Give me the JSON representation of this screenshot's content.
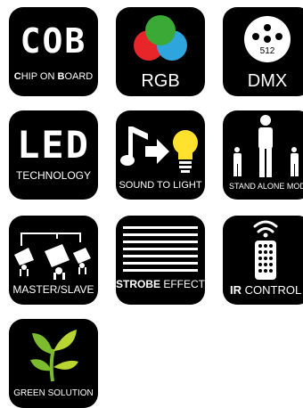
{
  "tiles": [
    {
      "id": "cob",
      "big": "COB",
      "caption_a": "C",
      "caption_b": "HIP ON ",
      "caption_c": "B",
      "caption_d": "OARD",
      "icon": "cob-dot-letters-icon"
    },
    {
      "id": "rgb",
      "caption": "RGB",
      "icon": "rgb-circles-icon",
      "colors": [
        "#e8262a",
        "#3aa935",
        "#2fa5dd"
      ]
    },
    {
      "id": "dmx",
      "caption": "DMX",
      "connector_label": "512",
      "icon": "dmx-connector-icon"
    },
    {
      "id": "led",
      "big": "LED",
      "caption": "TECHNOLOGY",
      "icon": "led-dot-letters-icon"
    },
    {
      "id": "sound",
      "caption": "SOUND TO LIGHT",
      "icon": "note-to-bulb-icon",
      "colors": [
        "#ffe12e"
      ]
    },
    {
      "id": "standalone",
      "caption": "STAND ALONE MODE",
      "icon": "standalone-figures-icon"
    },
    {
      "id": "masterslave",
      "caption": "MASTER/SLAVE",
      "icon": "linked-spotlights-icon"
    },
    {
      "id": "strobe",
      "caption_bold": "STROBE",
      "caption_rest": " EFFECT",
      "icon": "strobe-lines-icon"
    },
    {
      "id": "ir",
      "caption_bold": "IR",
      "caption_rest": " CONTROL",
      "icon": "remote-control-icon"
    },
    {
      "id": "green",
      "caption": "GREEN SOLUTION",
      "icon": "green-sprout-icon",
      "colors": [
        "#7dbb2e",
        "#b9d531"
      ]
    }
  ]
}
